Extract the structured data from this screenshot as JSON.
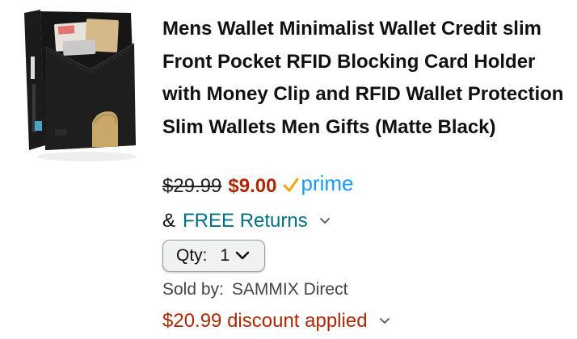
{
  "product": {
    "title": "Mens Wallet Minimalist Wallet Credit slim Front Pocket RFID Blocking Card Holder with Money Clip and RFID Wallet Protection Slim Wallets Men Gifts (Matte Black)",
    "image_icon": "wallet-product-image"
  },
  "pricing": {
    "list_price": "$29.99",
    "sale_price": "$9.00",
    "prime_label": "prime",
    "sale_color": "#b12704",
    "prime_color": "#1a98ff",
    "check_color": "#f7a41d"
  },
  "returns": {
    "prefix": "&",
    "label": "FREE Returns",
    "link_color": "#007185"
  },
  "quantity": {
    "label": "Qty:",
    "value": "1"
  },
  "seller": {
    "label": "Sold by:",
    "name": "SAMMIX Direct"
  },
  "discount": {
    "text": "$20.99 discount applied"
  }
}
